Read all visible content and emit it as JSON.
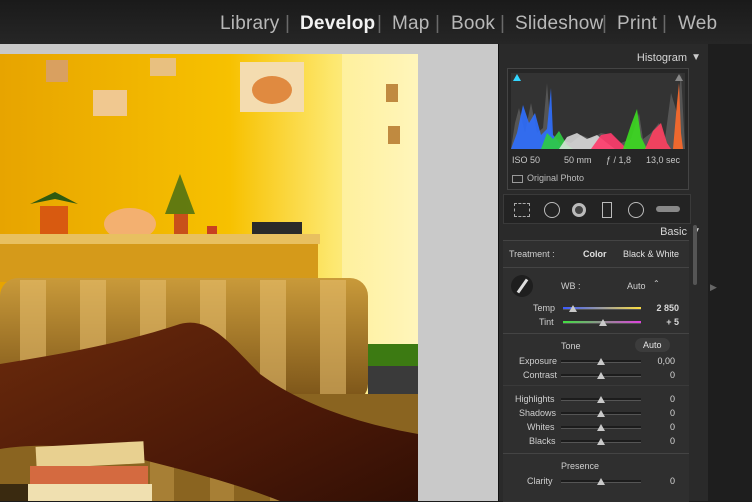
{
  "modules": [
    "Library",
    "Develop",
    "Map",
    "Book",
    "Slideshow",
    "Print",
    "Web"
  ],
  "active_module": "Develop",
  "histogram": {
    "title": "Histogram",
    "iso": "ISO 50",
    "focal": "50 mm",
    "aperture": "ƒ / 1,8",
    "shutter": "13,0 sec",
    "original_photo": "Original Photo"
  },
  "basic": {
    "title": "Basic",
    "treatment_label": "Treatment :",
    "color": "Color",
    "bw": "Black & White",
    "wb_label": "WB :",
    "wb_value": "Auto",
    "temp_label": "Temp",
    "temp_value": "2 850",
    "tint_label": "Tint",
    "tint_value": "+ 5",
    "tone_label": "Tone",
    "tone_auto": "Auto",
    "exposure_label": "Exposure",
    "exposure_value": "0,00",
    "contrast_label": "Contrast",
    "contrast_value": "0",
    "highlights_label": "Highlights",
    "highlights_value": "0",
    "shadows_label": "Shadows",
    "shadows_value": "0",
    "whites_label": "Whites",
    "whites_value": "0",
    "blacks_label": "Blacks",
    "blacks_value": "0",
    "presence_label": "Presence",
    "clarity_label": "Clarity",
    "clarity_value": "0"
  },
  "colors": {
    "accent_yellow": "#f2c200",
    "panel_bg": "#2a2a2a"
  }
}
